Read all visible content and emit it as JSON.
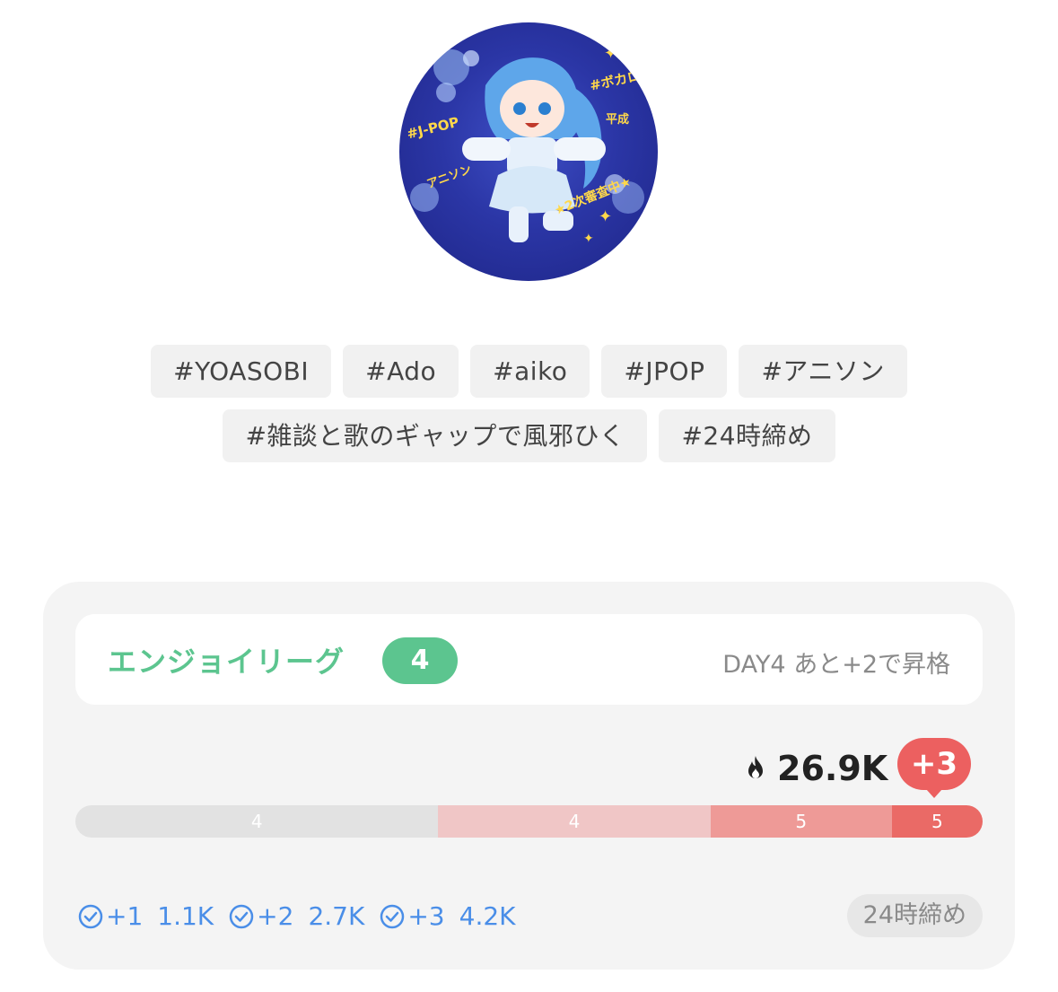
{
  "avatar": {
    "text_jpop": "#J-POP",
    "text_vocaloid": "#ボカロ",
    "text_heisei": "平成",
    "text_anison": "アニソン",
    "text_audition": "★2次審査中★"
  },
  "tags": {
    "row1": [
      "#YOASOBI",
      "#Ado",
      "#aiko",
      "#JPOP",
      "#アニソン"
    ],
    "row2": [
      "#雑談と歌のギャップで風邪ひく",
      "#24時締め"
    ]
  },
  "league": {
    "name": "エンジョイリーグ",
    "level": "4",
    "status": "DAY4 あと+2で昇格",
    "score": "26.9K",
    "delta": "+3",
    "bar_segments": [
      {
        "label": "4",
        "share": 0.4,
        "color": "#e2e2e2"
      },
      {
        "label": "4",
        "share": 0.3,
        "color": "#f0c6c6"
      },
      {
        "label": "5",
        "share": 0.2,
        "color": "#ee9a97"
      },
      {
        "label": "5",
        "share": 0.1,
        "color": "#ea6a66"
      }
    ],
    "rewards": [
      {
        "level": "+1",
        "amount": "1.1K"
      },
      {
        "level": "+2",
        "amount": "2.7K"
      },
      {
        "level": "+3",
        "amount": "4.2K"
      }
    ],
    "deadline": "24時締め"
  },
  "colors": {
    "accent_green": "#5cc58f",
    "accent_red": "#ec6060",
    "reward_blue": "#4a8ee8"
  },
  "icons": [
    "flame-icon",
    "check-circle-icon"
  ]
}
